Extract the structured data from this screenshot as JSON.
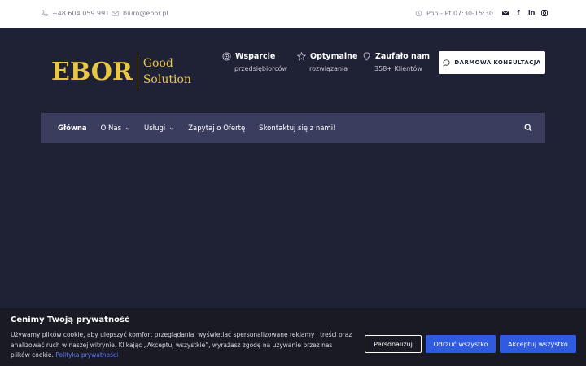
{
  "topbar": {
    "phone": "+48 604 059 991",
    "email": "biuro@ebor.pl",
    "hours": "Pon - Pt 07:30-15:30",
    "social_icons": [
      "email-icon",
      "facebook-icon",
      "linkedin-icon",
      "instagram-icon"
    ]
  },
  "logo": {
    "main": "EBOR",
    "line1": "Good",
    "line2": "Solution",
    "color": "#e9c845"
  },
  "features": [
    {
      "title": "Wsparcie",
      "sub": "przedsiębiorców",
      "icon": "target-icon"
    },
    {
      "title": "Optymalne",
      "sub": "rozwiązania",
      "icon": "star-icon"
    },
    {
      "title": "Zaufało nam",
      "sub": "358+ Klientów",
      "icon": "lightbulb-icon"
    }
  ],
  "cta": {
    "label": "DARMOWA KONSULTACJA",
    "icon": "chat-icon"
  },
  "nav": {
    "items": [
      {
        "label": "Główna"
      },
      {
        "label": "O Nas"
      },
      {
        "label": "Usługi"
      },
      {
        "label": "Zapytaj o Ofertę"
      },
      {
        "label": "Skontaktuj się z nami!"
      }
    ],
    "search_icon": "search-icon"
  },
  "cookie": {
    "title": "Cenimy Twoją prywatność",
    "text": "Używamy plików cookie, aby ulepszyć komfort przeglądania, wyświetlać spersonalizowane reklamy i treści oraz analizować ruch w naszej witrynie. Klikając „Akceptuj wszystkie”, wyrażasz zgodę na używanie przez nas plików cookie.",
    "link": "Polityka prywatności",
    "buttons": {
      "customize": "Personalizuj",
      "reject": "Odrzuć wszystko",
      "accept": "Akceptuj wszystko"
    }
  },
  "colors": {
    "background": "#1f2135",
    "nav": "#3a3d5e",
    "accent_blue": "#2f5be0",
    "gold": "#e9c845"
  }
}
